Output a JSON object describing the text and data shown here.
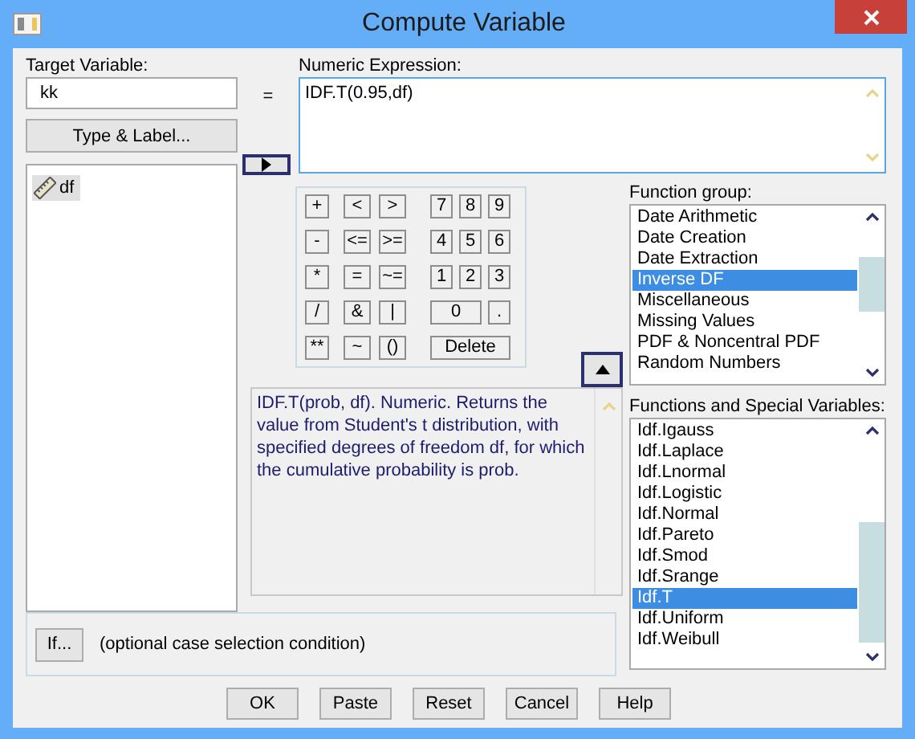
{
  "window": {
    "title": "Compute Variable"
  },
  "target_variable": {
    "label": "Target Variable:",
    "value": "kk"
  },
  "equals": "=",
  "type_label_button": "Type & Label...",
  "variables": [
    {
      "name": "df",
      "selected": true
    }
  ],
  "numeric_expression": {
    "label": "Numeric Expression:",
    "value": "IDF.T(0.95,df)"
  },
  "keypad": [
    [
      {
        "label": "+",
        "kind": "op"
      },
      {
        "label": "<",
        "kind": "op"
      },
      {
        "label": ">",
        "kind": "op"
      },
      {
        "label": "7",
        "kind": "digit"
      },
      {
        "label": "8",
        "kind": "digit"
      },
      {
        "label": "9",
        "kind": "digit"
      }
    ],
    [
      {
        "label": "-",
        "kind": "op"
      },
      {
        "label": "<=",
        "kind": "op"
      },
      {
        "label": ">=",
        "kind": "op"
      },
      {
        "label": "4",
        "kind": "digit"
      },
      {
        "label": "5",
        "kind": "digit"
      },
      {
        "label": "6",
        "kind": "digit"
      }
    ],
    [
      {
        "label": "*",
        "kind": "op"
      },
      {
        "label": "=",
        "kind": "op"
      },
      {
        "label": "~=",
        "kind": "op"
      },
      {
        "label": "1",
        "kind": "digit"
      },
      {
        "label": "2",
        "kind": "digit"
      },
      {
        "label": "3",
        "kind": "digit"
      }
    ],
    [
      {
        "label": "/",
        "kind": "op"
      },
      {
        "label": "&",
        "kind": "op"
      },
      {
        "label": "|",
        "kind": "op"
      },
      {
        "label": "0",
        "kind": "zero"
      },
      {
        "label": ".",
        "kind": "digit"
      }
    ],
    [
      {
        "label": "**",
        "kind": "op"
      },
      {
        "label": "~",
        "kind": "op"
      },
      {
        "label": "()",
        "kind": "op"
      },
      {
        "label": "Delete",
        "kind": "delete"
      }
    ]
  ],
  "description": "IDF.T(prob, df). Numeric. Returns the value from Student's t distribution, with specified degrees of freedom df, for which the cumulative probability is prob.",
  "function_group": {
    "label": "Function group:",
    "items": [
      {
        "name": "Date Arithmetic",
        "selected": false
      },
      {
        "name": "Date Creation",
        "selected": false
      },
      {
        "name": "Date Extraction",
        "selected": false
      },
      {
        "name": "Inverse DF",
        "selected": true
      },
      {
        "name": "Miscellaneous",
        "selected": false
      },
      {
        "name": "Missing Values",
        "selected": false
      },
      {
        "name": "PDF & Noncentral PDF",
        "selected": false
      },
      {
        "name": "Random Numbers",
        "selected": false
      }
    ]
  },
  "functions": {
    "label": "Functions and Special Variables:",
    "items": [
      {
        "name": "Idf.Igauss",
        "selected": false
      },
      {
        "name": "Idf.Laplace",
        "selected": false
      },
      {
        "name": "Idf.Lnormal",
        "selected": false
      },
      {
        "name": "Idf.Logistic",
        "selected": false
      },
      {
        "name": "Idf.Normal",
        "selected": false
      },
      {
        "name": "Idf.Pareto",
        "selected": false
      },
      {
        "name": "Idf.Smod",
        "selected": false
      },
      {
        "name": "Idf.Srange",
        "selected": false
      },
      {
        "name": "Idf.T",
        "selected": true
      },
      {
        "name": "Idf.Uniform",
        "selected": false
      },
      {
        "name": "Idf.Weibull",
        "selected": false
      }
    ]
  },
  "if_condition": {
    "button": "If...",
    "text": "(optional case selection condition)"
  },
  "buttons": [
    "OK",
    "Paste",
    "Reset",
    "Cancel",
    "Help"
  ]
}
